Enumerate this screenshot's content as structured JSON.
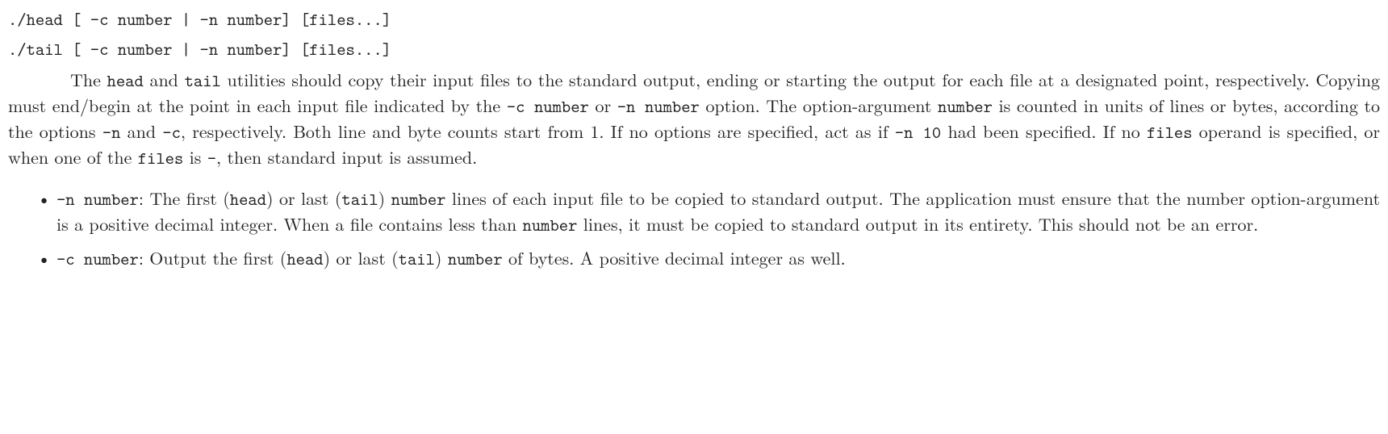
{
  "synopsis": {
    "head": "./head [ -c number | -n number] [files...]",
    "tail": "./tail [ -c number | -n number] [files...]"
  },
  "body": {
    "t1": "The ",
    "c1": "head",
    "t2": " and ",
    "c2": "tail",
    "t3": " utilities should copy their input files to the standard output, ending or starting the output for each file at a designated point, respectively. Copying must end/begin at the point in each input file indicated by the ",
    "c3": "-c number",
    "t4": " or ",
    "c4": "-n number",
    "t5": " option. The option-argument ",
    "c5": "number",
    "t6": " is counted in units of lines or bytes, according to the options ",
    "c6": "-n",
    "t7": " and ",
    "c7": "-c",
    "t8": ", respectively. Both line and byte counts start from 1. If no options are specified, act as if ",
    "c8": "-n 10",
    "t9": " had been specified. If no ",
    "c9": "files",
    "t10": " operand is specified, or when one of the ",
    "c10": "files",
    "t11": " is ",
    "c11": "-",
    "t12": ", then standard input is assumed."
  },
  "opt_n": {
    "flag": "-n number",
    "t1": ": The first (",
    "c1": "head",
    "t2": ") or last (",
    "c2": "tail",
    "t3": ") ",
    "c3": "number",
    "t4": " lines of each input file to be copied to standard output. The application must ensure that the number option-argument is a positive decimal integer. When a file contains less than ",
    "c4": "number",
    "t5": " lines, it must be copied to standard output in its entirety. This should not be an error."
  },
  "opt_c": {
    "flag": "-c number",
    "t1": ": Output the first (",
    "c1": "head",
    "t2": ") or last (",
    "c2": "tail",
    "t3": ") ",
    "c3": "number",
    "t4": " of bytes. A positive decimal integer as well."
  }
}
